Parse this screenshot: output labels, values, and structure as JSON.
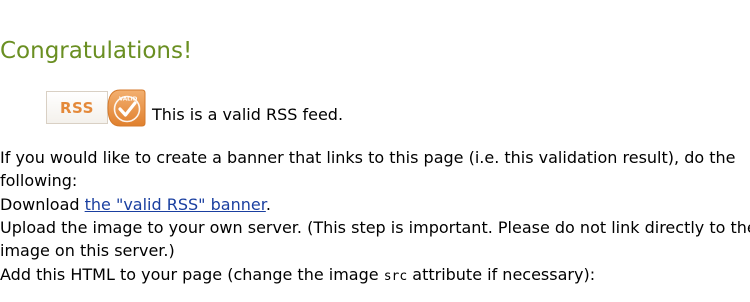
{
  "heading": "Congratulations!",
  "badge": {
    "rss_text": "RSS",
    "valid_text": "VALID",
    "icon": "valid-rss-badge"
  },
  "feed_status": "This is a valid RSS feed.",
  "instructions": {
    "intro_line1": "If you would like to create a banner that links to this page (i.e. this validation result), do the",
    "intro_line2": "following:",
    "download_prefix": "Download ",
    "download_link": "the \"valid RSS\" banner",
    "download_suffix": ".",
    "upload_line1": "Upload the image to your own server. (This step is important. Please do not link directly to the",
    "upload_line2": "image on this server.)",
    "add_html_prefix": "Add this HTML to your page (change the image ",
    "add_html_code": "src",
    "add_html_suffix": " attribute if necessary):"
  },
  "colors": {
    "heading": "#6a8f22",
    "link": "#1a3fa0",
    "badge_orange": "#e4893a"
  }
}
